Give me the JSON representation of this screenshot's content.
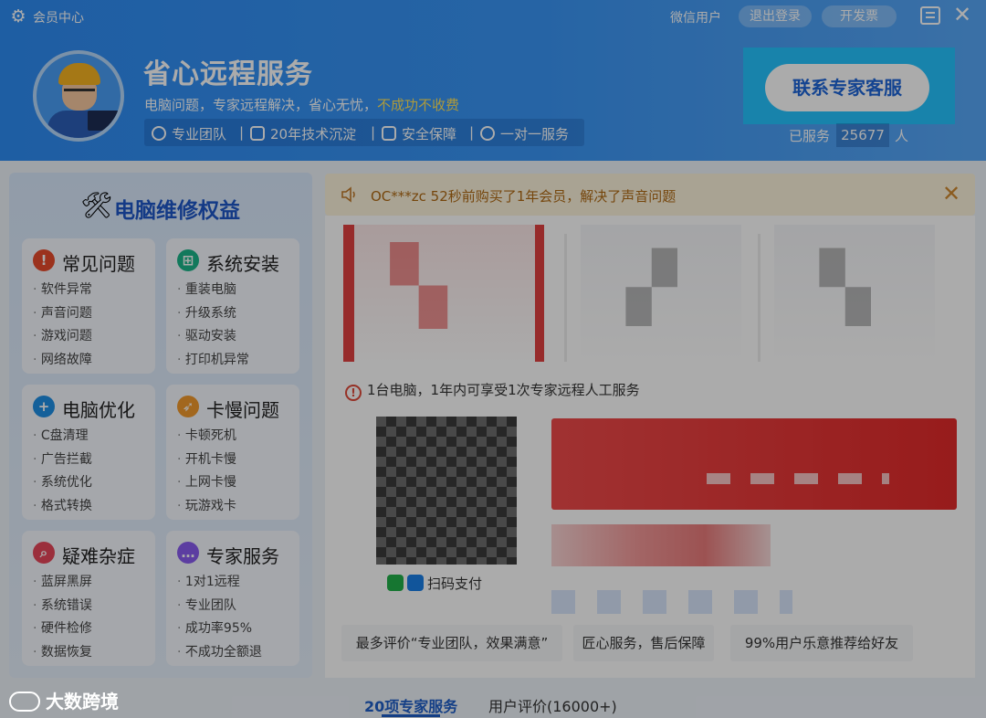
{
  "titlebar": {
    "title": "会员中心",
    "user": "微信用户",
    "logout_label": "退出登录",
    "invoice_label": "开发票"
  },
  "header": {
    "brand": "省心远程服务",
    "slogan_prefix": "电脑问题，专家远程解决，省心无忧，",
    "slogan_highlight": "不成功不收费",
    "tags": [
      "专业团队",
      "20年技术沉淀",
      "安全保障",
      "一对一服务"
    ],
    "contact_button": "联系专家客服",
    "served_label": "已服务",
    "served_count": "25677",
    "served_unit": "人"
  },
  "left_panel": {
    "title": "电脑维修权益",
    "cards": [
      {
        "title": "常见问题",
        "icon": "alert-icon",
        "color": "#e84b2c",
        "items": [
          "软件异常",
          "声音问题",
          "游戏问题",
          "网络故障"
        ]
      },
      {
        "title": "系统安装",
        "icon": "grid-icon",
        "color": "#1bb58a",
        "items": [
          "重装电脑",
          "升级系统",
          "驱动安装",
          "打印机异常"
        ]
      },
      {
        "title": "电脑优化",
        "icon": "plus-icon",
        "color": "#1f8fe6",
        "items": [
          "C盘清理",
          "广告拦截",
          "系统优化",
          "格式转换"
        ]
      },
      {
        "title": "卡慢问题",
        "icon": "rocket-icon",
        "color": "#f29a2e",
        "items": [
          "卡顿死机",
          "开机卡慢",
          "上网卡慢",
          "玩游戏卡"
        ]
      },
      {
        "title": "疑难杂症",
        "icon": "search-icon",
        "color": "#e8465a",
        "items": [
          "蓝屏黑屏",
          "系统错误",
          "硬件检修",
          "数据恢复"
        ]
      },
      {
        "title": "专家服务",
        "icon": "chat-icon",
        "color": "#8a5cf0",
        "items": [
          "1对1远程",
          "专业团队",
          "成功率95%",
          "不成功全额退"
        ]
      }
    ]
  },
  "notice": {
    "text": "OC***zc 52秒前购买了1年会员，解决了声音问题"
  },
  "plans": {
    "info": "1台电脑，1年内可享受1次专家远程人工服务",
    "pay_label": "扫码支付"
  },
  "reviews": [
    "最多评价“专业团队，效果满意”",
    "匠心服务，售后保障",
    "99%用户乐意推荐给好友"
  ],
  "tabs": [
    "20项专家服务",
    "用户评价(16000+)"
  ],
  "watermark": "大数跨境"
}
